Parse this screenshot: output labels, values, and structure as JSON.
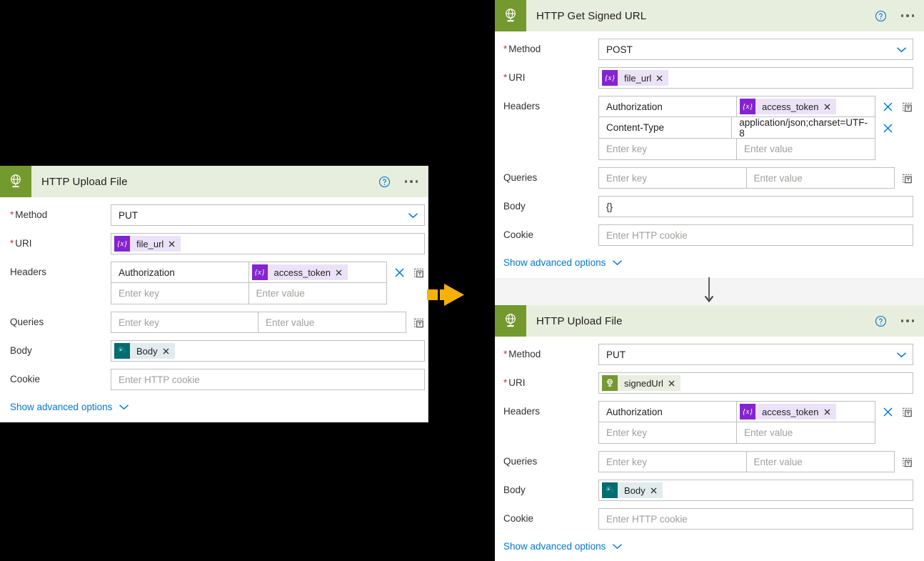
{
  "colors": {
    "connector_green": "#74992e",
    "header_bg": "#e8eedd",
    "accent_blue": "#0078d4",
    "required_red": "#d13438",
    "variable_purple": "#8523d0",
    "sharepoint_teal": "#036c70",
    "arrow_orange": "#f5b10a",
    "canvas_black": "#000000",
    "pane_gray": "#f4f4f4"
  },
  "labels": {
    "method": "Method",
    "uri": "URI",
    "headers": "Headers",
    "queries": "Queries",
    "body": "Body",
    "cookie": "Cookie",
    "show_advanced": "Show advanced options"
  },
  "placeholders": {
    "enter_key": "Enter key",
    "enter_value": "Enter value",
    "cookie": "Enter HTTP cookie"
  },
  "icons": {
    "connector": "globe-icon",
    "help": "help-icon",
    "more": "ellipsis-icon",
    "dropdown": "chevron-down-icon",
    "delete_row": "close-icon",
    "add_row": "add-dynamic-content-icon",
    "token_remove": "close-icon"
  },
  "left_card": {
    "title": "HTTP Upload File",
    "method": {
      "label": "Method",
      "value": "PUT",
      "required": true
    },
    "uri": {
      "label": "URI",
      "required": true,
      "token": {
        "text": "file_url",
        "kind": "variable",
        "icon_glyph": "{x}"
      }
    },
    "headers": {
      "label": "Headers",
      "rows": [
        {
          "key": "Authorization",
          "value_token": {
            "text": "access_token",
            "kind": "variable",
            "icon_glyph": "{x}"
          },
          "deletable": true
        },
        {
          "key": "",
          "value": "",
          "key_placeholder": "Enter key",
          "value_placeholder": "Enter value",
          "deletable": false
        }
      ]
    },
    "queries": {
      "label": "Queries",
      "rows": [
        {
          "key": "",
          "value": "",
          "key_placeholder": "Enter key",
          "value_placeholder": "Enter value"
        }
      ]
    },
    "body": {
      "label": "Body",
      "token": {
        "text": "Body",
        "kind": "sharepoint",
        "icon_glyph": "s"
      }
    },
    "cookie": {
      "label": "Cookie",
      "value": "",
      "placeholder": "Enter HTTP cookie"
    },
    "advanced": "Show advanced options"
  },
  "right_pane": {
    "card_1": {
      "title": "HTTP Get Signed URL",
      "method": {
        "label": "Method",
        "value": "POST",
        "required": true
      },
      "uri": {
        "label": "URI",
        "required": true,
        "token": {
          "text": "file_url",
          "kind": "variable",
          "icon_glyph": "{x}"
        }
      },
      "headers": {
        "label": "Headers",
        "rows": [
          {
            "key": "Authorization",
            "value_token": {
              "text": "access_token",
              "kind": "variable",
              "icon_glyph": "{x}"
            },
            "deletable": true
          },
          {
            "key": "Content-Type",
            "value": "application/json;charset=UTF-8",
            "deletable": true
          },
          {
            "key": "",
            "value": "",
            "key_placeholder": "Enter key",
            "value_placeholder": "Enter value",
            "deletable": false
          }
        ]
      },
      "queries": {
        "label": "Queries",
        "rows": [
          {
            "key": "",
            "value": "",
            "key_placeholder": "Enter key",
            "value_placeholder": "Enter value"
          }
        ]
      },
      "body": {
        "label": "Body",
        "value": "{}"
      },
      "cookie": {
        "label": "Cookie",
        "value": "",
        "placeholder": "Enter HTTP cookie"
      },
      "advanced": "Show advanced options"
    },
    "card_2": {
      "title": "HTTP Upload File",
      "method": {
        "label": "Method",
        "value": "PUT",
        "required": true
      },
      "uri": {
        "label": "URI",
        "required": true,
        "token": {
          "text": "signedUrl",
          "kind": "http",
          "icon_glyph": "globe"
        }
      },
      "headers": {
        "label": "Headers",
        "rows": [
          {
            "key": "Authorization",
            "value_token": {
              "text": "access_token",
              "kind": "variable",
              "icon_glyph": "{x}"
            },
            "deletable": true
          },
          {
            "key": "",
            "value": "",
            "key_placeholder": "Enter key",
            "value_placeholder": "Enter value",
            "deletable": false
          }
        ]
      },
      "queries": {
        "label": "Queries",
        "rows": [
          {
            "key": "",
            "value": "",
            "key_placeholder": "Enter key",
            "value_placeholder": "Enter value"
          }
        ]
      },
      "body": {
        "label": "Body",
        "token": {
          "text": "Body",
          "kind": "sharepoint",
          "icon_glyph": "s"
        }
      },
      "cookie": {
        "label": "Cookie",
        "value": "",
        "placeholder": "Enter HTTP cookie"
      },
      "advanced": "Show advanced options"
    }
  }
}
